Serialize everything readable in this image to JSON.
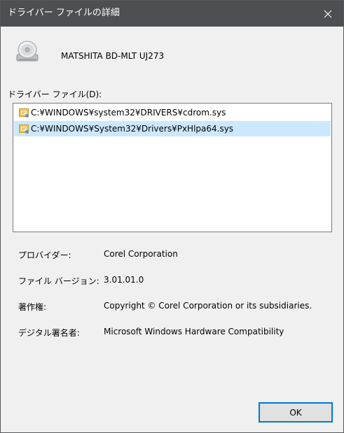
{
  "window": {
    "title": "ドライバー ファイルの詳細",
    "close_icon": "close-icon"
  },
  "device": {
    "icon": "optical-drive-icon",
    "name": "MATSHITA BD-MLT UJ273"
  },
  "files": {
    "label": "ドライバー ファイル(D):",
    "items": [
      {
        "path": "C:¥WINDOWS¥system32¥DRIVERS¥cdrom.sys",
        "selected": false
      },
      {
        "path": "C:¥WINDOWS¥System32¥Drivers¥PxHlpa64.sys",
        "selected": true
      }
    ]
  },
  "info": {
    "provider": {
      "label": "プロバイダー:",
      "value": "Corel Corporation"
    },
    "version": {
      "label": "ファイル バージョン:",
      "value": "3.01.01.0"
    },
    "copyright": {
      "label": "著作権:",
      "value": "Copyright © Corel Corporation or its subsidiaries."
    },
    "signer": {
      "label": "デジタル署名者:",
      "value": "Microsoft Windows Hardware Compatibility"
    }
  },
  "buttons": {
    "ok_label": "OK"
  },
  "colors": {
    "titlebar": "#4d4f53",
    "selection": "#cce8ff",
    "accent_border": "#0078d7"
  }
}
